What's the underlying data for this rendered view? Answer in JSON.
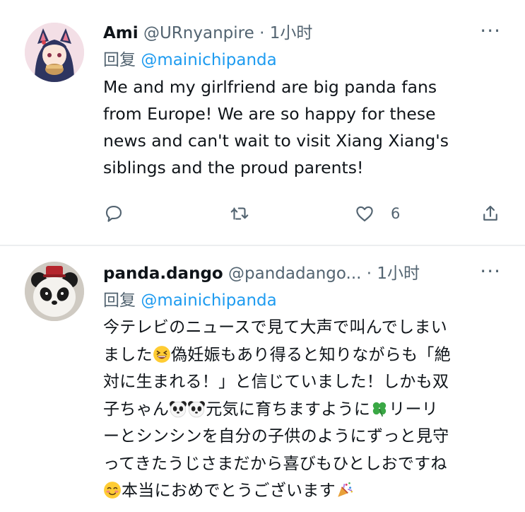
{
  "tweets": [
    {
      "name": "Ami",
      "handle": "@URnyanpire",
      "sep": "·",
      "time": "1小时",
      "reply_prefix": "回复",
      "reply_to": "@mainichipanda",
      "text_lines": [
        "Me and my girlfriend are big panda fans",
        "from Europe! We are so happy for these",
        "news and can't wait to visit Xiang Xiang's",
        "siblings and the proud parents!"
      ],
      "like_count": "6",
      "more": "···"
    },
    {
      "name": "panda.dango",
      "handle": "@pandadango...",
      "sep": "·",
      "time": "1小时",
      "reply_prefix": "回复",
      "reply_to": "@mainichipanda",
      "text": {
        "l1": "今テレビのニュースで見て大声で叫んでしまい",
        "l2a": "ました",
        "l2b": "偽妊娠もあり得ると知りながらも「絶",
        "l3": "対に生まれる！」と信じていました！しかも双",
        "l4a": "子ちゃん",
        "l4b": "元気に育ちますように",
        "l4c": "リーリ",
        "l5": "ーとシンシンを自分の子供のようにずっと見守",
        "l6": "ってきたうじさまだから喜びもひとしおですね",
        "l7": "本当におめでとうございます"
      },
      "emojis": [
        "grinning-squinting-face",
        "panda-face",
        "panda-face",
        "four-leaf-clover",
        "smiling-face-with-blush",
        "party-popper"
      ],
      "more": "···"
    }
  ],
  "colors": {
    "text": "#0f1419",
    "secondary": "#536471",
    "link": "#1d9bf0",
    "divider": "#eceef0"
  }
}
